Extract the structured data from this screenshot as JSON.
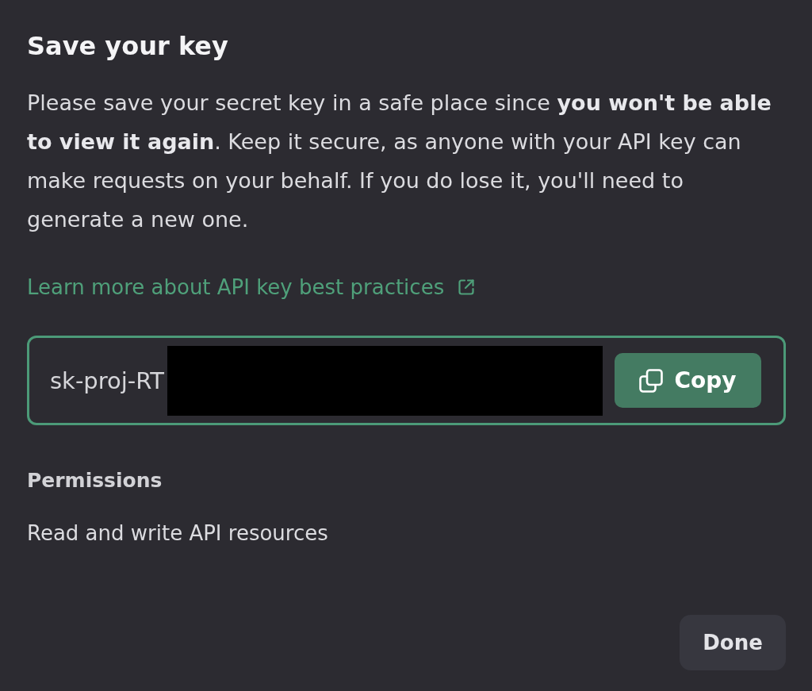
{
  "dialog": {
    "title": "Save your key",
    "description": "Please save your secret key in a safe place since **you won't be able to view it again**. Keep it secure, as anyone with your API key can make requests on your behalf. If you do lose it, you'll need to generate a new one.",
    "link": {
      "label": "Learn more about API key best practices",
      "external": true
    },
    "key_field": {
      "value": "sk-proj-RT",
      "redacted": true,
      "focused": true
    },
    "copy_button": {
      "label": "Copy"
    },
    "permissions": {
      "label": "Permissions",
      "value": "Read and write API resources"
    },
    "buttons": [
      {
        "label": "Done"
      }
    ]
  }
}
